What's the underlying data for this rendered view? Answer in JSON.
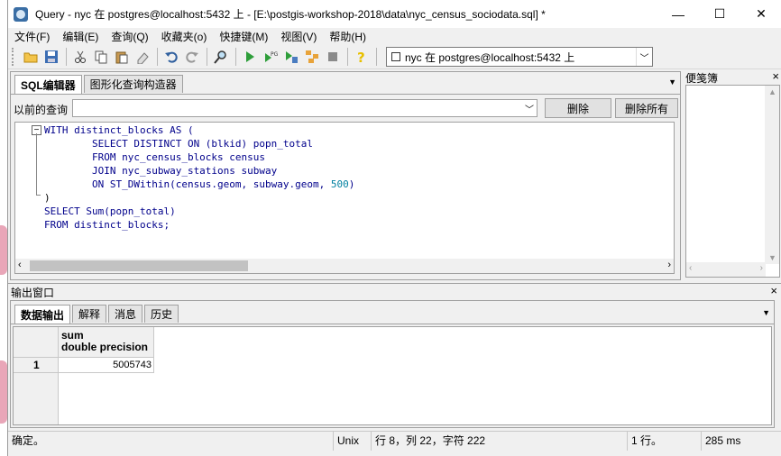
{
  "window": {
    "title": "Query - nyc 在  postgres@localhost:5432 上 - [E:\\postgis-workshop-2018\\data\\nyc_census_sociodata.sql] *",
    "minimize": "—",
    "maximize": "☐",
    "close": "✕"
  },
  "menu": [
    "文件(F)",
    "编辑(E)",
    "查询(Q)",
    "收藏夹(o)",
    "快捷键(M)",
    "视图(V)",
    "帮助(H)"
  ],
  "toolbar": {
    "connection": "nyc 在  postgres@localhost:5432 上"
  },
  "editor": {
    "tabs": [
      "SQL编辑器",
      "图形化查询构造器"
    ],
    "prev_query_label": "以前的查询",
    "delete_button": "删除",
    "delete_all_button": "删除所有"
  },
  "sql_lines": [
    "WITH distinct_blocks AS (",
    "        SELECT DISTINCT ON (blkid) popn_total",
    "        FROM nyc_census_blocks census",
    "        JOIN nyc_subway_stations subway",
    "        ON ST_DWithin(census.geom, subway.geom, 500)",
    ")",
    "SELECT Sum(popn_total)",
    "FROM distinct_blocks;"
  ],
  "scratch": {
    "title": "便笺簿",
    "close": "×"
  },
  "output": {
    "title": "输出窗口",
    "close": "×",
    "tabs": [
      "数据输出",
      "解释",
      "消息",
      "历史"
    ],
    "column_name": "sum",
    "column_type": "double precision",
    "row_number": "1",
    "value": "5005743"
  },
  "status": {
    "message": "确定。",
    "line_ending": "Unix",
    "position": "行 8，列 22，字符 222",
    "rows": "1 行。",
    "time": "285 ms"
  }
}
